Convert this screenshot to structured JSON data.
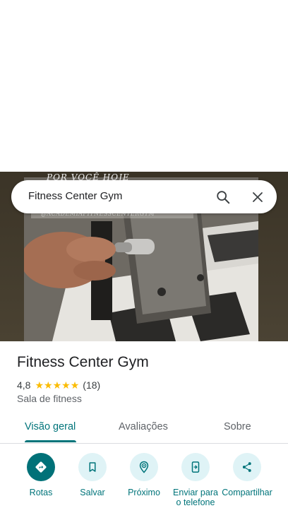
{
  "search": {
    "query": "Fitness Center Gym"
  },
  "hero": {
    "caption": "POR VOCÊ HOJE",
    "handle": "@ACADEMIAFITNESSCENTERGYM"
  },
  "place": {
    "name": "Fitness Center Gym",
    "rating": "4,8",
    "stars": 5,
    "review_count": "(18)",
    "category": "Sala de fitness"
  },
  "tabs": [
    {
      "label": "Visão geral",
      "active": true
    },
    {
      "label": "Avaliações",
      "active": false
    },
    {
      "label": "Sobre",
      "active": false
    }
  ],
  "actions": [
    {
      "label": "Rotas",
      "icon": "directions-icon"
    },
    {
      "label": "Salvar",
      "icon": "bookmark-icon"
    },
    {
      "label": "Próximo",
      "icon": "nearby-icon"
    },
    {
      "label": "Enviar para o telefone",
      "icon": "send-to-phone-icon"
    },
    {
      "label": "Compartilhar",
      "icon": "share-icon"
    }
  ],
  "colors": {
    "accent": "#00747a",
    "primary_button": "#007178",
    "action_bg": "#dff3f6",
    "star": "#fbbc04"
  }
}
